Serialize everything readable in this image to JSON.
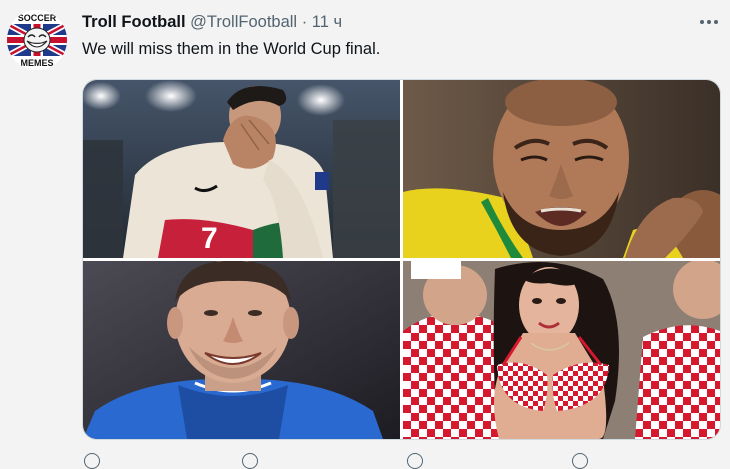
{
  "tweet": {
    "author_name": "Troll Football",
    "author_handle": "@TrollFootball",
    "separator": "·",
    "time": "11 ч",
    "text": "We will miss them in the World Cup final.",
    "avatar_text_top": "SOCCER",
    "avatar_text_bottom": "MEMES"
  },
  "colors": {
    "background": "#f3f3f3",
    "text": "#0f1419",
    "muted": "#536471"
  },
  "media": {
    "jersey_number": "7"
  },
  "icons": [
    "more-icon",
    "reply-icon",
    "retweet-icon",
    "like-icon",
    "share-icon"
  ]
}
